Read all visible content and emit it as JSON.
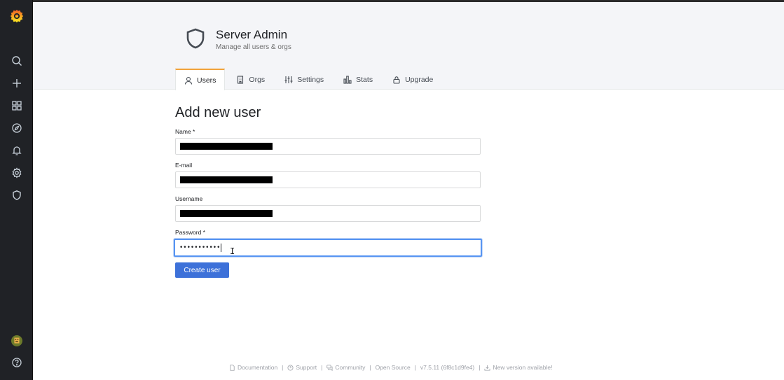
{
  "header": {
    "title": "Server Admin",
    "subtitle": "Manage all users & orgs"
  },
  "tabs": [
    {
      "label": "Users",
      "icon": "user-icon",
      "active": true
    },
    {
      "label": "Orgs",
      "icon": "building-icon",
      "active": false
    },
    {
      "label": "Settings",
      "icon": "sliders-icon",
      "active": false
    },
    {
      "label": "Stats",
      "icon": "bar-chart-icon",
      "active": false
    },
    {
      "label": "Upgrade",
      "icon": "lock-icon",
      "active": false
    }
  ],
  "form": {
    "title": "Add new user",
    "name_label": "Name *",
    "email_label": "E-mail",
    "username_label": "Username",
    "password_label": "Password *",
    "password_value": "•••••••••••",
    "submit_label": "Create user"
  },
  "sidebar": {
    "items": [
      "grafana-logo-icon",
      "search-icon",
      "plus-icon",
      "dashboards-icon",
      "explore-icon",
      "alerting-icon",
      "configuration-icon",
      "server-admin-icon",
      "user-avatar",
      "help-icon"
    ]
  },
  "footer": {
    "documentation": "Documentation",
    "support": "Support",
    "community": "Community",
    "open_source": "Open Source",
    "version": "v7.5.11 (6f8c1d9fe4)",
    "new_version": "New version available!",
    "separator": "|"
  },
  "colors": {
    "sidebar_bg": "#202226",
    "accent": "#f2a33a",
    "primary_button": "#3d71d9",
    "focus_border": "#5794f2"
  }
}
